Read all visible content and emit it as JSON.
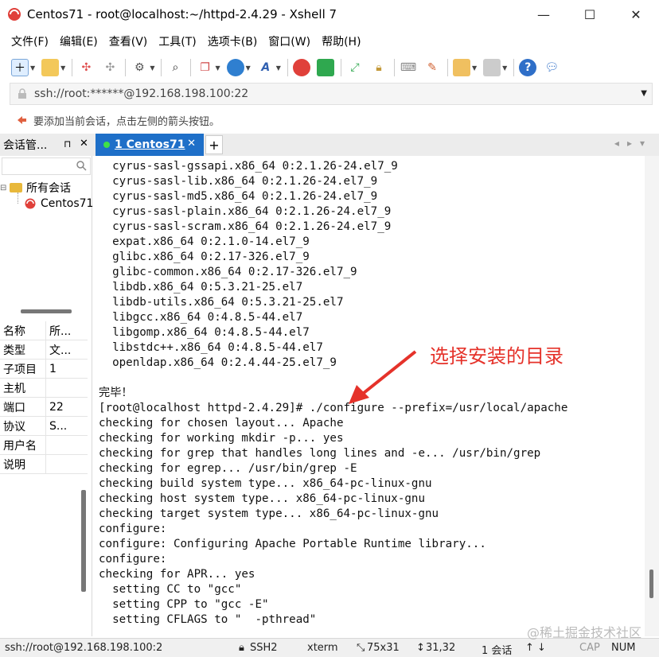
{
  "window": {
    "title": "Centos71 - root@localhost:~/httpd-2.4.29 - Xshell 7",
    "controls": {
      "minimize": "—",
      "maximize": "☐",
      "close": "✕"
    }
  },
  "menu": [
    "文件(F)",
    "编辑(E)",
    "查看(V)",
    "工具(T)",
    "选项卡(B)",
    "窗口(W)",
    "帮助(H)"
  ],
  "address": {
    "value": "ssh://root:******@192.168.198.100:22"
  },
  "hint": "要添加当前会话，点击左侧的箭头按钮。",
  "sidebar": {
    "header": "会话管...",
    "pin": "⊓",
    "close": "✕",
    "tree_root": "所有会话",
    "tree_child": "Centos71"
  },
  "tab": {
    "label": "1 Centos71",
    "close": "✕",
    "add": "+"
  },
  "properties": [
    {
      "key": "名称",
      "value": "所..."
    },
    {
      "key": "类型",
      "value": "文..."
    },
    {
      "key": "子项目",
      "value": "1"
    },
    {
      "key": "主机",
      "value": ""
    },
    {
      "key": "端口",
      "value": "22"
    },
    {
      "key": "协议",
      "value": "S..."
    },
    {
      "key": "用户名",
      "value": ""
    },
    {
      "key": "说明",
      "value": ""
    }
  ],
  "terminal": {
    "lines": [
      "  cyrus-sasl-gssapi.x86_64 0:2.1.26-24.el7_9",
      "  cyrus-sasl-lib.x86_64 0:2.1.26-24.el7_9",
      "  cyrus-sasl-md5.x86_64 0:2.1.26-24.el7_9",
      "  cyrus-sasl-plain.x86_64 0:2.1.26-24.el7_9",
      "  cyrus-sasl-scram.x86_64 0:2.1.26-24.el7_9",
      "  expat.x86_64 0:2.1.0-14.el7_9",
      "  glibc.x86_64 0:2.17-326.el7_9",
      "  glibc-common.x86_64 0:2.17-326.el7_9",
      "  libdb.x86_64 0:5.3.21-25.el7",
      "  libdb-utils.x86_64 0:5.3.21-25.el7",
      "  libgcc.x86_64 0:4.8.5-44.el7",
      "  libgomp.x86_64 0:4.8.5-44.el7",
      "  libstdc++.x86_64 0:4.8.5-44.el7",
      "  openldap.x86_64 0:2.4.44-25.el7_9",
      "",
      "完毕！",
      "[root@localhost httpd-2.4.29]# ./configure --prefix=/usr/local/apache",
      "checking for chosen layout... Apache",
      "checking for working mkdir -p... yes",
      "checking for grep that handles long lines and -e... /usr/bin/grep",
      "checking for egrep... /usr/bin/grep -E",
      "checking build system type... x86_64-pc-linux-gnu",
      "checking host system type... x86_64-pc-linux-gnu",
      "checking target system type... x86_64-pc-linux-gnu",
      "configure:",
      "configure: Configuring Apache Portable Runtime library...",
      "configure:",
      "checking for APR... yes",
      "  setting CC to \"gcc\"",
      "  setting CPP to \"gcc -E\"",
      "  setting CFLAGS to \"  -pthread\""
    ]
  },
  "annotation": "选择安装的目录",
  "status": {
    "connection": "ssh://root@192.168.198.100:2",
    "protocol": "SSH2",
    "term": "xterm",
    "size": "75x31",
    "cursor": "31,32",
    "sessions": "1 会话",
    "cap": "CAP",
    "num": "NUM"
  },
  "watermark": "@稀土掘金技术社区",
  "colors": {
    "accent": "#1e6fc8",
    "annotation": "#e5322a"
  }
}
